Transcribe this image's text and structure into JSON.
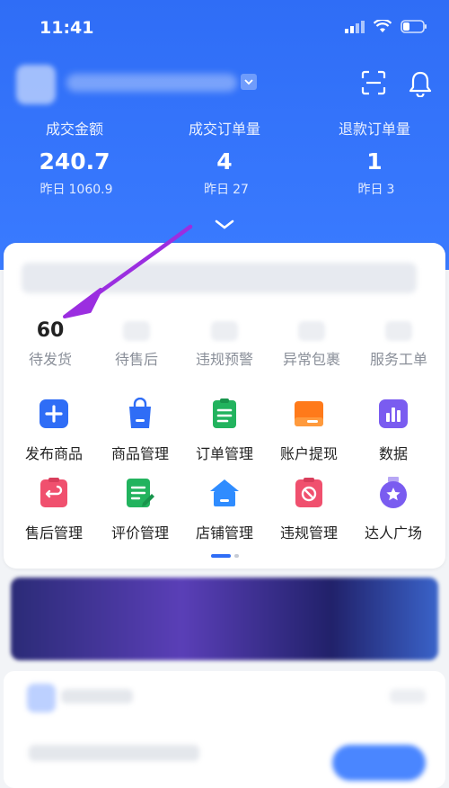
{
  "status_bar": {
    "time": "11:41"
  },
  "stats": [
    {
      "label": "成交金额",
      "value": "240.7",
      "yday_label": "昨日",
      "yday_value": "1060.9"
    },
    {
      "label": "成交订单量",
      "value": "4",
      "yday_label": "昨日",
      "yday_value": "27"
    },
    {
      "label": "退款订单量",
      "value": "1",
      "yday_label": "昨日",
      "yday_value": "3"
    }
  ],
  "orders": [
    {
      "value": "60",
      "label": "待发货"
    },
    {
      "value": "",
      "label": "待售后"
    },
    {
      "value": "",
      "label": "违规预警"
    },
    {
      "value": "",
      "label": "异常包裹"
    },
    {
      "value": "",
      "label": "服务工单"
    }
  ],
  "tiles": [
    {
      "label": "发布商品",
      "icon": "plus-icon",
      "color": "#2f6df6"
    },
    {
      "label": "商品管理",
      "icon": "shopping-bag-icon",
      "color": "#2f6df6"
    },
    {
      "label": "订单管理",
      "icon": "clipboard-icon",
      "color": "#22b35e"
    },
    {
      "label": "账户提现",
      "icon": "wallet-icon",
      "color": "#ff7a1a"
    },
    {
      "label": "数据",
      "icon": "bar-chart-icon",
      "color": "#7a5cf0"
    },
    {
      "label": "售后管理",
      "icon": "return-icon",
      "color": "#f0506e"
    },
    {
      "label": "评价管理",
      "icon": "edit-note-icon",
      "color": "#22b35e"
    },
    {
      "label": "店铺管理",
      "icon": "store-icon",
      "color": "#2f8cff"
    },
    {
      "label": "违规管理",
      "icon": "prohibited-icon",
      "color": "#f0506e"
    },
    {
      "label": "达人广场",
      "icon": "star-badge-icon",
      "color": "#7a5cf0"
    }
  ],
  "colors": {
    "brand_blue": "#2f6df6",
    "annotation_arrow": "#9b2ee0"
  }
}
